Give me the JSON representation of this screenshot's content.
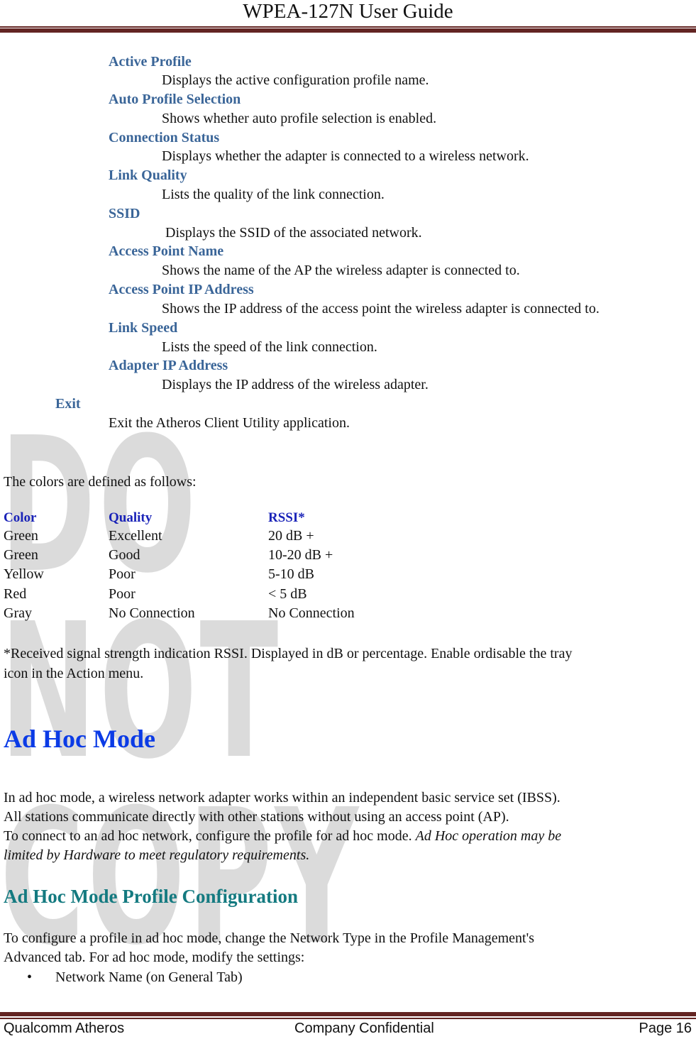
{
  "header": {
    "title": "WPEA-127N User Guide"
  },
  "definitions": [
    {
      "term": "Active Profile",
      "desc": "Displays the active configuration profile name."
    },
    {
      "term": "Auto Profile Selection",
      "desc": "Shows whether auto profile selection is enabled."
    },
    {
      "term": "Connection Status",
      "desc": "Displays whether the adapter is connected to a wireless network."
    },
    {
      "term": "Link Quality",
      "desc": "Lists the quality of the link connection."
    },
    {
      "term": "SSID",
      "desc": "Displays the SSID of the associated network."
    },
    {
      "term": "Access Point Name",
      "desc": "Shows the name of the AP the wireless adapter is connected to."
    },
    {
      "term": "Access Point IP Address",
      "desc": "Shows the IP address of the access point the wireless adapter is connected to."
    },
    {
      "term": "Link Speed",
      "desc": "Lists the speed of the link connection."
    },
    {
      "term": "Adapter IP Address",
      "desc": "Displays the IP address of the wireless adapter."
    }
  ],
  "exit": {
    "term": "Exit",
    "desc": "Exit the Atheros Client Utility application."
  },
  "watermark": "DO NOT COPY",
  "colors_intro": "The colors are defined as follows:",
  "color_table": {
    "headers": [
      "Color",
      "Quality",
      "RSSI*"
    ],
    "rows": [
      [
        "Green",
        "Excellent",
        "20 dB +"
      ],
      [
        "Green",
        "Good",
        "10-20 dB +"
      ],
      [
        "Yellow",
        "Poor",
        "5-10 dB"
      ],
      [
        "Red",
        "Poor",
        "< 5 dB"
      ],
      [
        "Gray",
        "No Connection",
        "No Connection"
      ]
    ]
  },
  "footnote": {
    "line1": "*Received signal strength indication RSSI. Displayed in dB or percentage. Enable ordisable the tray",
    "line2": "icon in the Action menu."
  },
  "adhoc": {
    "heading": "Ad Hoc Mode",
    "para_line1": "In ad hoc mode, a wireless network adapter works within an independent basic service set (IBSS).",
    "para_line2": "All stations communicate directly with other stations without using an access point (AP).",
    "para_line3": "To connect to an ad hoc network, configure the profile for ad hoc mode. ",
    "para_line3_italic": "Ad Hoc operation may be",
    "para_line4_italic": "limited by Hardware to meet regulatory requirements."
  },
  "adhoc_config": {
    "heading": "Ad Hoc Mode Profile Configuration",
    "para_line1": "To configure a profile in ad hoc mode, change the Network Type in the Profile Management's",
    "para_line2": "Advanced tab. For ad hoc mode, modify the settings:",
    "bullets": [
      "Network Name (on General Tab)"
    ]
  },
  "footer": {
    "left": "Qualcomm Atheros",
    "center": "Company Confidential",
    "right": "Page 16"
  }
}
